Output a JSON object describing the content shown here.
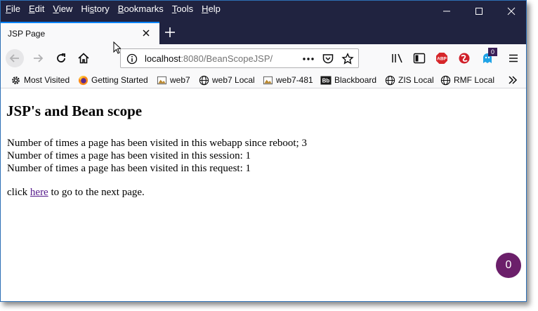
{
  "menu": {
    "file": {
      "ul": "F",
      "rest": "ile"
    },
    "edit": {
      "ul": "E",
      "rest": "dit"
    },
    "view": {
      "ul": "V",
      "rest": "iew"
    },
    "history": {
      "pre": "Hi",
      "ul": "s",
      "rest": "tory"
    },
    "bookmarks": {
      "ul": "B",
      "rest": "ookmarks"
    },
    "tools": {
      "ul": "T",
      "rest": "ools"
    },
    "help": {
      "ul": "H",
      "rest": "elp"
    }
  },
  "tab": {
    "title": "JSP Page"
  },
  "url": {
    "host": "localhost",
    "rest": ":8080/BeanScopeJSP/"
  },
  "badge_count": "0",
  "bookmarks": [
    {
      "label": "Most Visited",
      "icon": "gear-icon"
    },
    {
      "label": "Getting Started",
      "icon": "firefox-icon"
    },
    {
      "label": "web7",
      "icon": "image-icon"
    },
    {
      "label": "web7 Local",
      "icon": "globe-icon"
    },
    {
      "label": "web7-481",
      "icon": "image-icon"
    },
    {
      "label": "Blackboard",
      "icon": "blackboard-icon"
    },
    {
      "label": "ZIS Local",
      "icon": "globe-icon"
    },
    {
      "label": "RMF Local",
      "icon": "globe-icon"
    }
  ],
  "page": {
    "heading": "JSP's and Bean scope",
    "line1": "Number of times a page has been visited in this webapp since reboot; 3",
    "line2": "Number of times a page has been visited in this session: 1",
    "line3": "Number of times a page has been visited in this request: 1",
    "click_pre": "click ",
    "link": "here",
    "click_post": " to go to the next page."
  },
  "fab_count": "0",
  "colors": {
    "titlebar": "#202340",
    "link": "#551a8b",
    "fab": "#6b1f6a",
    "accent": "#0a84ff"
  }
}
